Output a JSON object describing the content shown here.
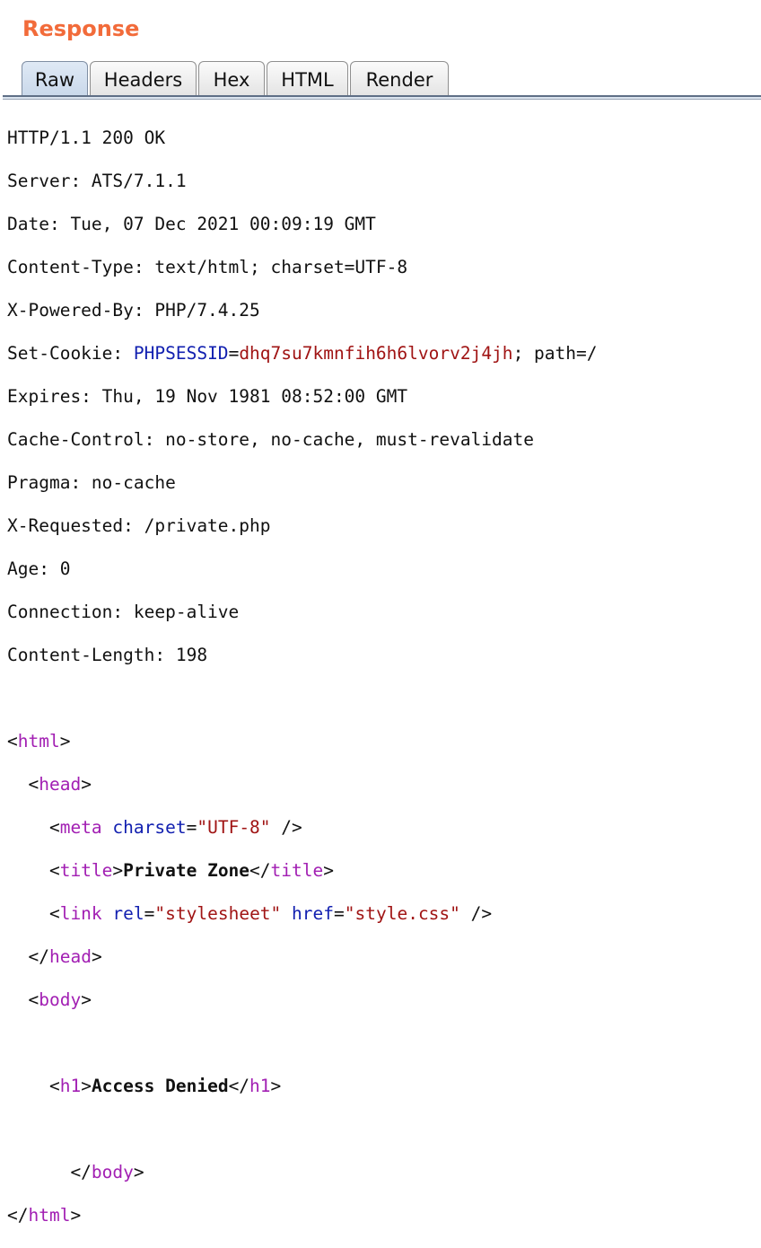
{
  "panel": {
    "title": "Response"
  },
  "tabs": [
    {
      "label": "Raw",
      "active": true
    },
    {
      "label": "Headers",
      "active": false
    },
    {
      "label": "Hex",
      "active": false
    },
    {
      "label": "HTML",
      "active": false
    },
    {
      "label": "Render",
      "active": false
    }
  ],
  "http": {
    "status_line": "HTTP/1.1 200 OK",
    "server": "Server: ATS/7.1.1",
    "date": "Date: Tue, 07 Dec 2021 00:09:19 GMT",
    "content_type": "Content-Type: text/html; charset=UTF-8",
    "powered_by": "X-Powered-By: PHP/7.4.25",
    "set_cookie_prefix": "Set-Cookie: ",
    "cookie_name": "PHPSESSID",
    "cookie_eq": "=",
    "cookie_value": "dhq7su7kmnfih6h6lvorv2j4jh",
    "cookie_suffix": "; path=/",
    "expires": "Expires: Thu, 19 Nov 1981 08:52:00 GMT",
    "cache_control": "Cache-Control: no-store, no-cache, must-revalidate",
    "pragma": "Pragma: no-cache",
    "x_requested": "X-Requested: /private.php",
    "age": "Age: 0",
    "connection": "Connection: keep-alive",
    "content_length": "Content-Length: 198"
  },
  "body": {
    "tag_html": "html",
    "tag_head": "head",
    "tag_meta": "meta",
    "attr_charset": "charset",
    "val_charset": "\"UTF-8\"",
    "tag_title": "title",
    "title_text": "Private Zone",
    "tag_link": "link",
    "attr_rel": "rel",
    "val_rel": "\"stylesheet\"",
    "attr_href": "href",
    "val_href": "\"style.css\"",
    "tag_body": "body",
    "tag_h1": "h1",
    "h1_text": "Access Denied"
  }
}
